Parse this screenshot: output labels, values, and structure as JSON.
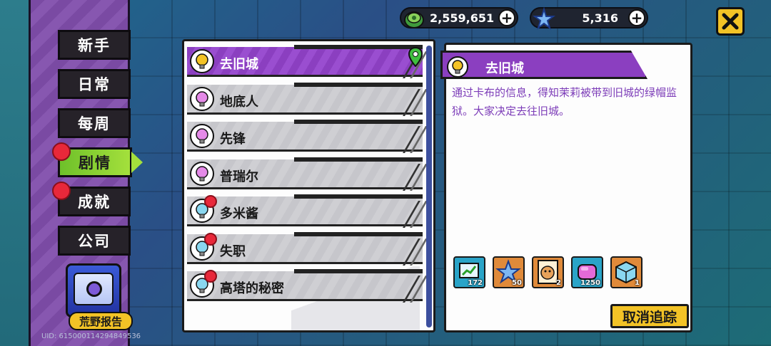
{
  "currencies": [
    {
      "icon": "coin-stack-icon",
      "value": "2,559,651"
    },
    {
      "icon": "blue-star-gem-icon",
      "value": "5,316"
    }
  ],
  "sidebar": {
    "tabs": [
      {
        "label": "新手",
        "badge": false,
        "active": false
      },
      {
        "label": "日常",
        "badge": false,
        "active": false
      },
      {
        "label": "每周",
        "badge": false,
        "active": false
      },
      {
        "label": "剧情",
        "badge": true,
        "active": true
      },
      {
        "label": "成就",
        "badge": true,
        "active": false
      },
      {
        "label": "公司",
        "badge": false,
        "active": false
      }
    ],
    "report_label": "荒野报告",
    "uid": "UID: 615000114294849536"
  },
  "quests": [
    {
      "name": "去旧城",
      "bulb_color": "#f3c326",
      "badge": false,
      "active": true
    },
    {
      "name": "地底人",
      "bulb_color": "#e58ae8",
      "badge": false,
      "active": false
    },
    {
      "name": "先锋",
      "bulb_color": "#e58ae8",
      "badge": false,
      "active": false
    },
    {
      "name": "普瑞尔",
      "bulb_color": "#e58ae8",
      "badge": false,
      "active": false
    },
    {
      "name": "多米酱",
      "bulb_color": "#8ad7f0",
      "badge": true,
      "active": false
    },
    {
      "name": "失职",
      "bulb_color": "#8ad7f0",
      "badge": true,
      "active": false
    },
    {
      "name": "高塔的秘密",
      "bulb_color": "#8ad7f0",
      "badge": true,
      "active": false
    }
  ],
  "detail": {
    "title": "去旧城",
    "description": "通过卡布的信息，得知茉莉被带到旧城的绿帽监狱。大家决定去往旧城。",
    "rewards": [
      {
        "icon": "chart-board-icon",
        "qty": "172",
        "bg": "#2aa4c8"
      },
      {
        "icon": "blue-star-gem-icon",
        "qty": "50",
        "bg": "#e08a3a"
      },
      {
        "icon": "pet-card-icon",
        "qty": "2",
        "bg": "#e08a3a"
      },
      {
        "icon": "jelly-cube-icon",
        "qty": "1250",
        "bg": "#2aa4c8"
      },
      {
        "icon": "ice-cube-icon",
        "qty": "1",
        "bg": "#e08a3a"
      }
    ],
    "cancel_label": "取消追踪"
  },
  "colors": {
    "accent_purple": "#8b3fc0",
    "active_green": "#8fd433",
    "badge_red": "#e8283a",
    "button_yellow": "#f3c326"
  }
}
